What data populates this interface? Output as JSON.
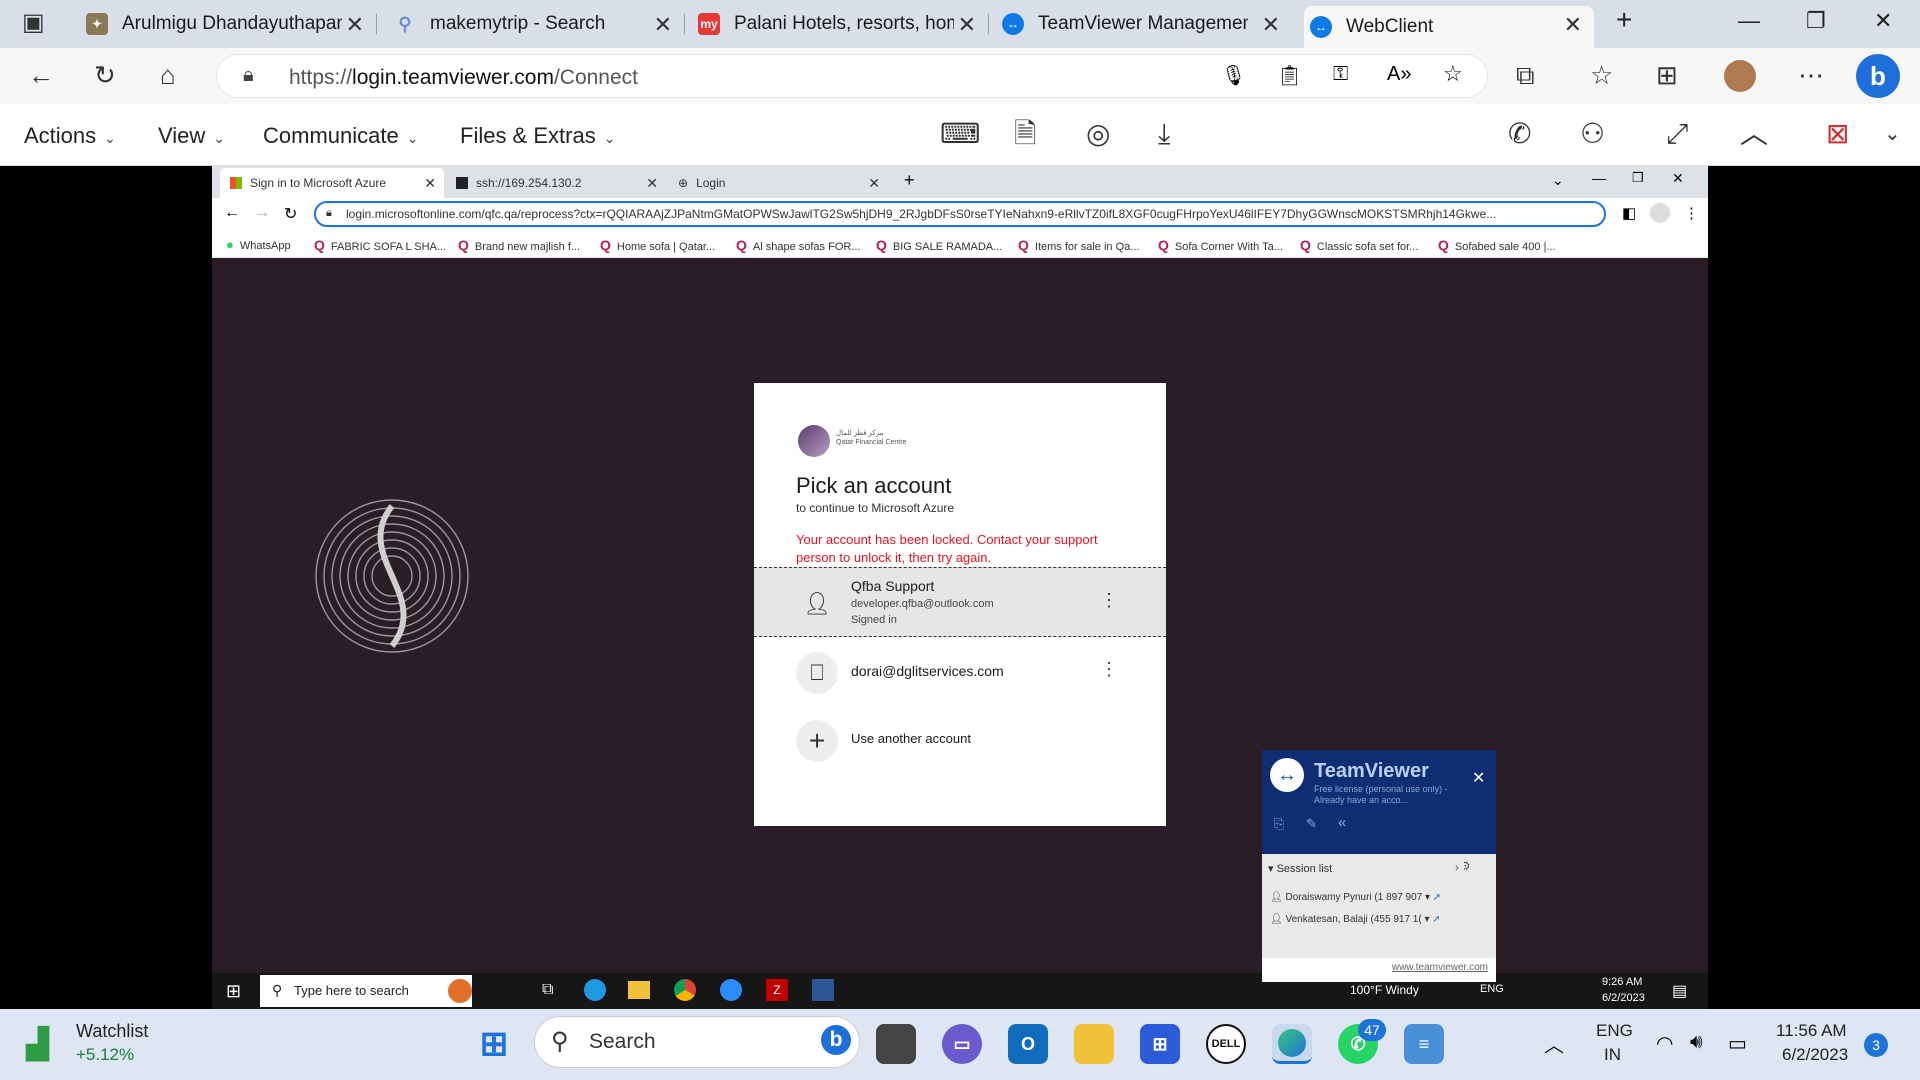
{
  "tabs": [
    {
      "label": "Arulmigu Dhandayuthapani"
    },
    {
      "label": "makemytrip - Search"
    },
    {
      "label": "Palani Hotels, resorts, hom"
    },
    {
      "label": "TeamViewer Management"
    },
    {
      "label": "WebClient"
    }
  ],
  "address": {
    "scheme": "https://",
    "host": "login.teamviewer.com",
    "path": "/Connect"
  },
  "tv_menu": {
    "actions": "Actions",
    "view": "View",
    "communicate": "Communicate",
    "files": "Files & Extras"
  },
  "remote": {
    "tabs": [
      {
        "label": "Sign in to Microsoft Azure"
      },
      {
        "label": "ssh://169.254.130.2"
      },
      {
        "label": "Login"
      }
    ],
    "url": "login.microsoftonline.com/qfc.qa/reprocess?ctx=rQQIARAAjZJPaNtmGMatOPWSwJawlTG2Sw5hjDH9_2RJgbDFsS0rseTYIeNahxn9-eRllvTZ0ifL8XGF0cugFHrpoYexU46lIFEY7DhyGGWnscMOKSTSMRhjh14Gkwe...",
    "bookmarks": [
      "WhatsApp",
      "FABRIC SOFA L SHA...",
      "Brand new majlish f...",
      "Home sofa | Qatar...",
      "Al shape sofas FOR...",
      "BIG SALE RAMADA...",
      "Items for sale in Qa...",
      "Sofa Corner With Ta...",
      "Classic sofa set for...",
      "Sofabed sale 400 |..."
    ]
  },
  "signin": {
    "title": "Pick an account",
    "subtitle": "to continue to Microsoft Azure",
    "error": "Your account has been locked. Contact your support person to unlock it, then try again.",
    "account1": {
      "name": "Qfba Support",
      "email": "developer.qfba@outlook.com",
      "status": "Signed in"
    },
    "account2": {
      "email": "dorai@dglitservices.com"
    },
    "another": "Use another account"
  },
  "tv_panel": {
    "brand": "TeamViewer",
    "license": "Free license (personal use only) - Already have an acco...",
    "session_list": "Session list",
    "sessions": [
      "Doraiswamy Pynuri (1 897 907",
      "Venkatesan, Balaji (455 917 1("
    ],
    "footer": "www.teamviewer.com"
  },
  "remote_taskbar": {
    "search": "Type here to search",
    "weather": "100°F  Windy",
    "lang": "ENG",
    "time": "9:26 AM",
    "date": "6/2/2023"
  },
  "taskbar": {
    "watchlist": "Watchlist",
    "change": "+5.12%",
    "search": "Search",
    "whatsapp_badge": "47",
    "lang1": "ENG",
    "lang2": "IN",
    "time": "11:56 AM",
    "date": "6/2/2023",
    "notif": "3"
  }
}
